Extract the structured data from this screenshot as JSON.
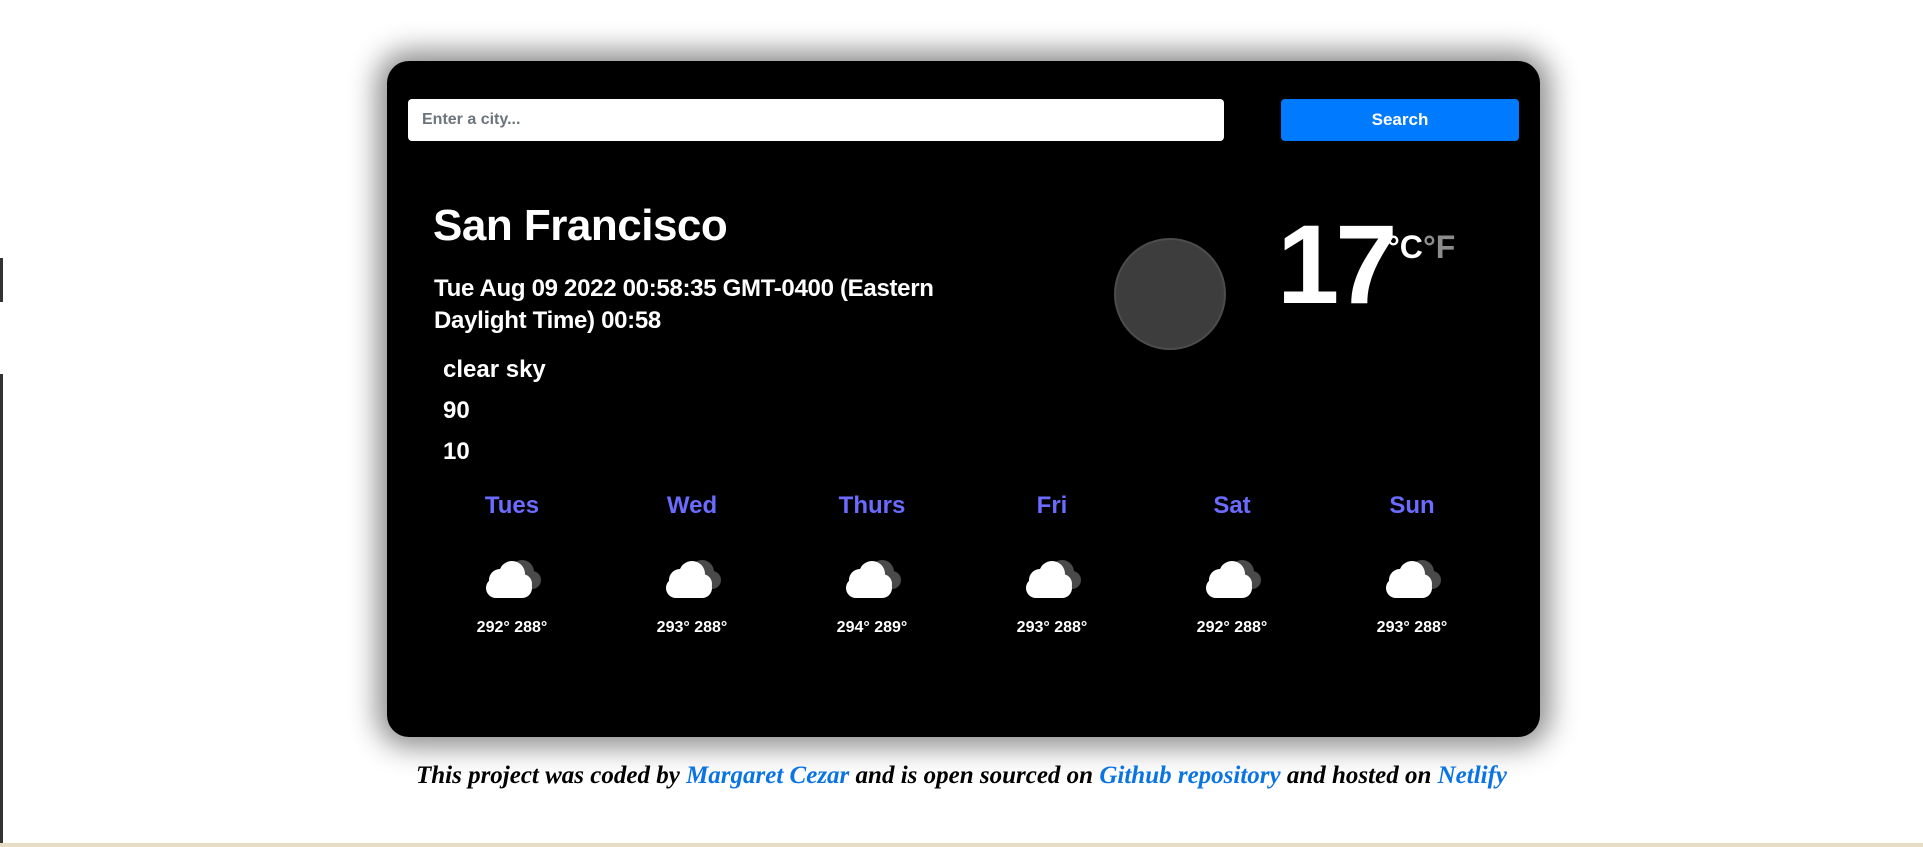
{
  "search": {
    "placeholder": "Enter a city...",
    "value": "",
    "button_label": "Search"
  },
  "current": {
    "city": "San Francisco",
    "datetime": "Tue Aug 09 2022 00:58:35 GMT-0400 (Eastern Daylight Time) 00:58",
    "description": "clear sky",
    "line2": "90",
    "line3": "10",
    "temperature": "17",
    "unit_c": "°C",
    "unit_f": "°F",
    "icon": "circle-icon"
  },
  "forecast": [
    {
      "day": "Tues",
      "temps": "292° 288°",
      "icon": "cloud-icon"
    },
    {
      "day": "Wed",
      "temps": "293° 288°",
      "icon": "cloud-icon"
    },
    {
      "day": "Thurs",
      "temps": "294° 289°",
      "icon": "cloud-icon"
    },
    {
      "day": "Fri",
      "temps": "293° 288°",
      "icon": "cloud-icon"
    },
    {
      "day": "Sat",
      "temps": "292° 288°",
      "icon": "cloud-icon"
    },
    {
      "day": "Sun",
      "temps": "293° 288°",
      "icon": "cloud-icon"
    }
  ],
  "footer": {
    "text1": "This project was coded by ",
    "author": "Margaret Cezar",
    "text2": " and is open sourced on ",
    "repo": "Github repository",
    "text3": " and hosted on ",
    "host": "Netlify"
  },
  "colors": {
    "card_bg": "#000000",
    "accent_button": "#007bff",
    "day_name": "#6b6bff",
    "link": "#0a74e4"
  }
}
